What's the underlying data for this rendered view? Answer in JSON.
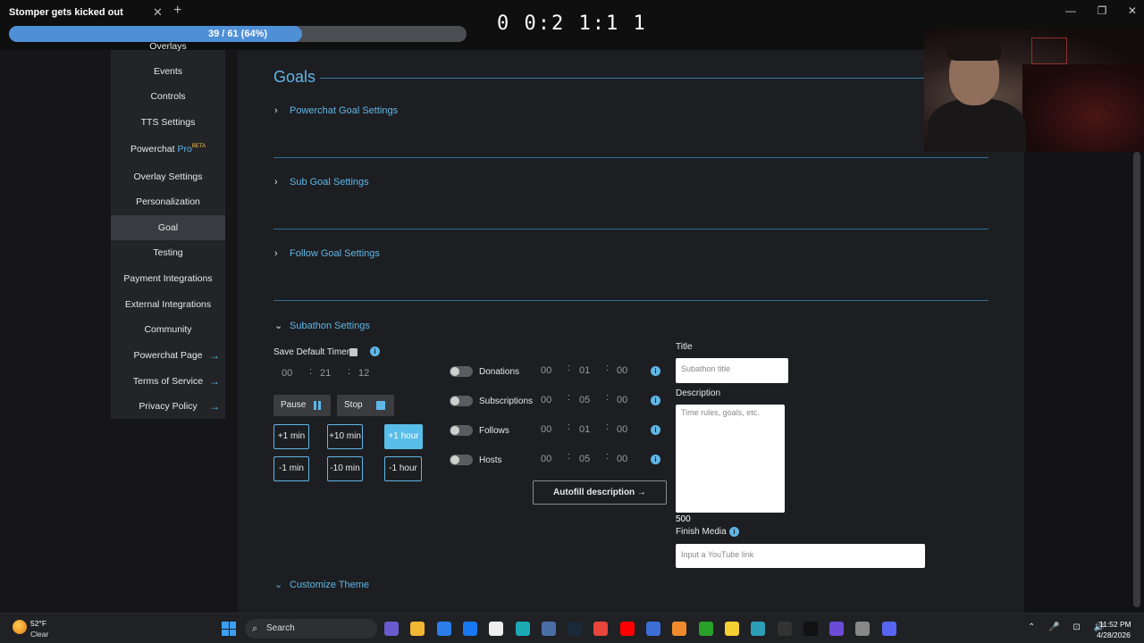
{
  "browser": {
    "tab_title": "Stomper gets kicked out",
    "tab_close": "✕",
    "new_tab": "+",
    "progress": {
      "label": "39 / 61 (64%)",
      "fraction": 0.64
    },
    "window_controls": [
      "—",
      "❐",
      "✕"
    ]
  },
  "overlay_timer": "0 0:2 1:1 1",
  "sidebar": {
    "items": [
      {
        "label": "Overlays",
        "active": false,
        "arrow": false
      },
      {
        "label": "Events",
        "active": false,
        "arrow": false
      },
      {
        "label": "Controls",
        "active": false,
        "arrow": false
      },
      {
        "label": "TTS Settings",
        "active": false,
        "arrow": false
      },
      {
        "label": "Powerchat",
        "pro": "Pro",
        "beta": "BETA",
        "active": false,
        "arrow": false
      },
      {
        "label": "Overlay Settings",
        "active": false,
        "arrow": false
      },
      {
        "label": "Personalization",
        "active": false,
        "arrow": false
      },
      {
        "label": "Goal",
        "active": true,
        "arrow": false
      },
      {
        "label": "Testing",
        "active": false,
        "arrow": false
      },
      {
        "label": "Payment Integrations",
        "active": false,
        "arrow": false
      },
      {
        "label": "External Integrations",
        "active": false,
        "arrow": false
      },
      {
        "label": "Community",
        "active": false,
        "arrow": false
      },
      {
        "label": "Powerchat Page",
        "active": false,
        "arrow": true
      },
      {
        "label": "Terms of Service",
        "active": false,
        "arrow": true
      },
      {
        "label": "Privacy Policy",
        "active": false,
        "arrow": true
      }
    ],
    "arrow_icon": "→"
  },
  "goals": {
    "title": "Goals",
    "sections": [
      {
        "label": "Powerchat Goal Settings",
        "expanded": false
      },
      {
        "label": "Sub Goal Settings",
        "expanded": false
      },
      {
        "label": "Follow Goal Settings",
        "expanded": false
      },
      {
        "label": "Subathon Settings",
        "expanded": true
      }
    ],
    "customize_theme": "Customize Theme"
  },
  "subathon": {
    "save_default_timer": "Save Default Timer",
    "timer": {
      "h": "00",
      "m": "21",
      "s": "12"
    },
    "pause": "Pause",
    "stop": "Stop",
    "add_buttons": [
      "+1 min",
      "+10 min",
      "+1 hour"
    ],
    "sub_buttons": [
      "-1 min",
      "-10 min",
      "-1 hour"
    ],
    "events": [
      {
        "label": "Donations",
        "h": "00",
        "m": "01",
        "s": "00"
      },
      {
        "label": "Subscriptions",
        "h": "00",
        "m": "05",
        "s": "00"
      },
      {
        "label": "Follows",
        "h": "00",
        "m": "01",
        "s": "00"
      },
      {
        "label": "Hosts",
        "h": "00",
        "m": "05",
        "s": "00"
      }
    ],
    "autofill": "Autofill description →",
    "title_label": "Title",
    "title_placeholder": "Subathon title",
    "description_label": "Description",
    "description_placeholder": "Time rules, goals, etc.",
    "char_count": "500",
    "finish_media_label": "Finish Media",
    "finish_media_placeholder": "Input a YouTube link"
  },
  "taskbar": {
    "weather_temp": "52°F",
    "weather_cond": "Clear",
    "search": "Search",
    "time": "11:52 PM",
    "date": "4/28/2026",
    "apps": [
      {
        "name": "copilot",
        "color": "#6a5acd"
      },
      {
        "name": "file-explorer",
        "color": "#f2b632"
      },
      {
        "name": "store",
        "color": "#2b7de9"
      },
      {
        "name": "facebook",
        "color": "#1877f2"
      },
      {
        "name": "amazon",
        "color": "#eeeeee"
      },
      {
        "name": "edge",
        "color": "#1ba9b4"
      },
      {
        "name": "calculator",
        "color": "#4a6fa5"
      },
      {
        "name": "steam",
        "color": "#1b2838"
      },
      {
        "name": "chrome",
        "color": "#e8453c"
      },
      {
        "name": "youtube",
        "color": "#ff0000"
      },
      {
        "name": "app-blue",
        "color": "#3b6ed6"
      },
      {
        "name": "app-orange",
        "color": "#f08b2d"
      },
      {
        "name": "xbox",
        "color": "#2aa12a"
      },
      {
        "name": "sticky-notes",
        "color": "#f5d033"
      },
      {
        "name": "app-teal",
        "color": "#2c9fb7"
      },
      {
        "name": "app-dark",
        "color": "#333333"
      },
      {
        "name": "tiktok",
        "color": "#111111"
      },
      {
        "name": "obs",
        "color": "#6c4bd6"
      },
      {
        "name": "app-gray",
        "color": "#888888"
      },
      {
        "name": "discord",
        "color": "#5865f2"
      }
    ],
    "tray": "⌃ 🎤 ⊡ 🔊"
  },
  "colors": {
    "accent": "#5fb7e6",
    "background": "#1d1e22",
    "sidebar": "#232428"
  }
}
